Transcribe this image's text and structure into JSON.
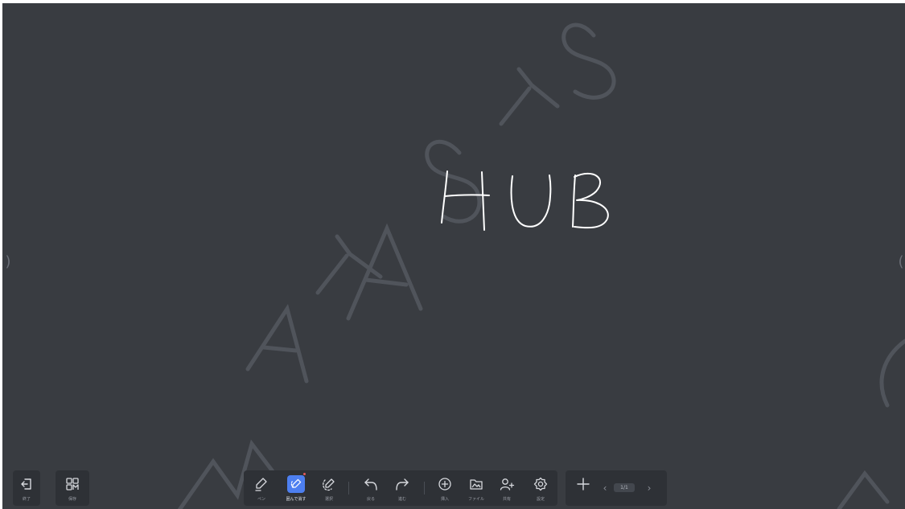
{
  "canvas": {
    "handwritten_text": "HUB",
    "watermark_text": "MAYASYS"
  },
  "edges": {
    "left_handle_icon": "chevron-right-icon",
    "right_handle_icon": "chevron-left-icon",
    "left_glyph": ")",
    "right_glyph": "("
  },
  "left_panel": {
    "items": [
      {
        "id": "exit",
        "label": "終了",
        "icon": "exit-icon"
      },
      {
        "id": "save",
        "label": "保存",
        "icon": "save-grid-icon"
      }
    ]
  },
  "main_toolbar": {
    "tools": [
      {
        "id": "pen",
        "label": "ペン",
        "icon": "pen-icon",
        "active": false
      },
      {
        "id": "lasso-erase",
        "label": "囲んで消す",
        "icon": "lasso-erase-icon",
        "active": true
      },
      {
        "id": "select",
        "label": "選択",
        "icon": "select-icon",
        "active": false
      },
      {
        "id": "undo",
        "label": "戻る",
        "icon": "undo-icon",
        "active": false
      },
      {
        "id": "redo",
        "label": "進む",
        "icon": "redo-icon",
        "active": false
      },
      {
        "id": "insert",
        "label": "挿入",
        "icon": "insert-plus-icon",
        "active": false
      },
      {
        "id": "file",
        "label": "ファイル",
        "icon": "folder-icon",
        "active": false
      },
      {
        "id": "share",
        "label": "共有",
        "icon": "add-user-icon",
        "active": false
      },
      {
        "id": "settings",
        "label": "設定",
        "icon": "gear-icon",
        "active": false
      }
    ]
  },
  "page_panel": {
    "add_icon": "plus-icon",
    "prev_glyph": "‹",
    "next_glyph": "›",
    "page_indicator": "1/1"
  },
  "colors": {
    "canvas_background": "#393c41",
    "toolbar_background": "#2e3136",
    "accent": "#4d7ff0",
    "ink": "#ffffff"
  }
}
